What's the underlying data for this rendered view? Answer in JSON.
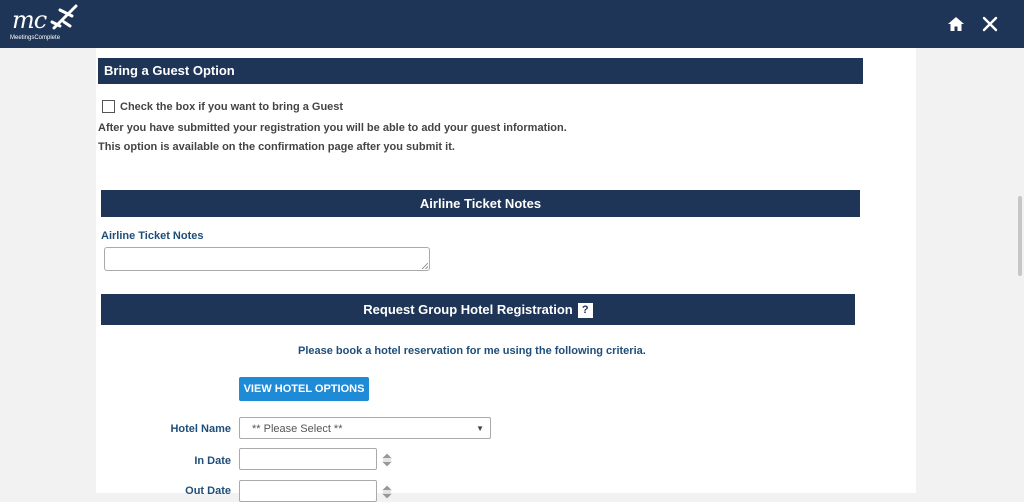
{
  "header": {
    "logo_text": "mc",
    "logo_subtext": "MeetingsComplete",
    "home_icon": "home-icon",
    "close_icon": "close-icon"
  },
  "guest": {
    "title": "Bring a Guest Option",
    "checkbox_label": "Check the box if you want to bring a Guest",
    "info_line1": "After you have submitted your registration you will be able to add your guest information.",
    "info_line2": "This option is available on the confirmation page after you submit it."
  },
  "airline": {
    "title": "Airline Ticket Notes",
    "field_label": "Airline Ticket Notes",
    "notes_value": ""
  },
  "hotel": {
    "title": "Request Group Hotel Registration",
    "help_icon": "?",
    "intro": "Please book a hotel reservation for me using the following criteria.",
    "view_button": "VIEW HOTEL OPTIONS",
    "hotel_name_label": "Hotel Name",
    "hotel_select_value": "** Please Select **",
    "in_date_label": "In Date",
    "out_date_label": "Out Date"
  },
  "colors": {
    "header_bg": "#1e3557",
    "accent_button": "#1f8ad6",
    "label_text": "#1e4e79"
  }
}
